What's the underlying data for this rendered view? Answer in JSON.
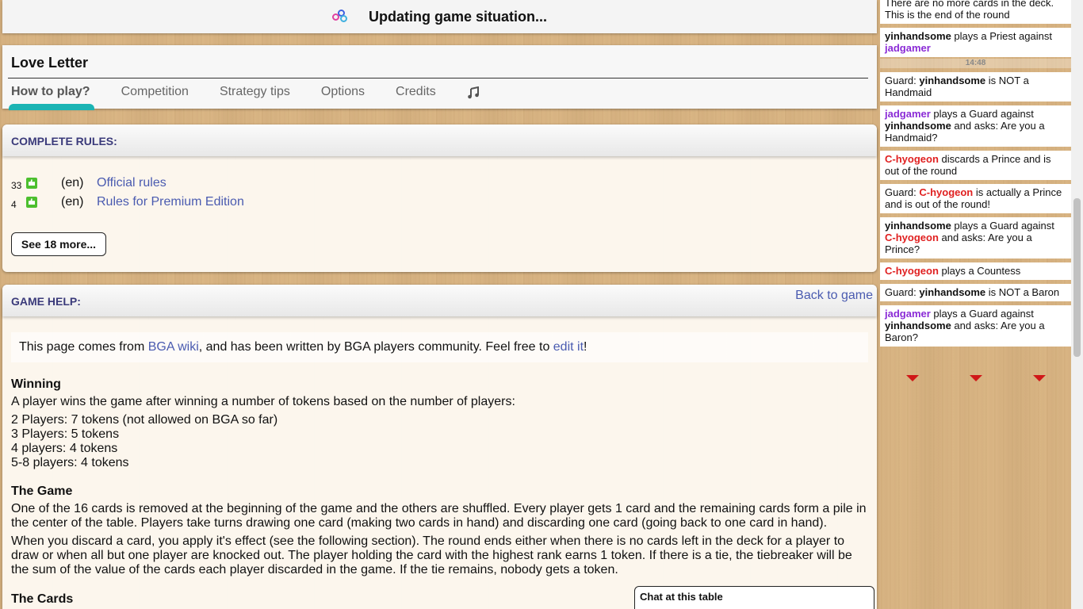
{
  "status": {
    "text": "Updating game situation..."
  },
  "header": {
    "title": "Love Letter",
    "tabs": [
      "How to play?",
      "Competition",
      "Strategy tips",
      "Options",
      "Credits"
    ]
  },
  "rules": {
    "title": "COMPLETE RULES:",
    "items": [
      {
        "count": "33",
        "lang": "(en)",
        "label": "Official rules"
      },
      {
        "count": "4",
        "lang": "(en)",
        "label": "Rules for Premium Edition"
      }
    ],
    "more_label": "See 18 more..."
  },
  "help": {
    "title": "GAME HELP:",
    "back_label": "Back to game",
    "notice_pre": "This page comes from ",
    "notice_link1": "BGA wiki",
    "notice_mid": ", and has been written by BGA players community. Feel free to ",
    "notice_link2": "edit it",
    "notice_post": "!",
    "winning_title": "Winning",
    "winning_intro": "A player wins the game after winning a number of tokens based on the number of players:",
    "winning_list": [
      "2 Players: 7 tokens (not allowed on BGA so far)",
      "3 Players: 5 tokens",
      "4 players: 4 tokens",
      "5-8 players: 4 tokens"
    ],
    "game_title": "The Game",
    "game_p1": "One of the 16 cards is removed at the beginning of the game and the others are shuffled. Every player gets 1 card and the remaining cards form a pile in the center of the table. Players take turns drawing one card (making two cards in hand) and discarding one card (going back to one card in hand).",
    "game_p2": "When you discard a card, you apply it's effect (see the following section). The round ends either when there is no cards left in the deck for a player to draw or when all but one player are knocked out. The player holding the card with the highest rank earns 1 token. If there is a tie, the tiebreaker will be the sum of the value of the cards each player discarded in the game. If the tie remains, nobody gets a token.",
    "cards_title": "The Cards"
  },
  "chat": {
    "title": "Chat at this table"
  },
  "log": {
    "time": "14:48",
    "entries": [
      {
        "parts": [
          [
            "",
            "There are no more cards in the deck. This is the end of the round"
          ]
        ]
      },
      {
        "parts": [
          [
            "yin",
            "yinhandsome"
          ],
          [
            "",
            " plays a Priest against "
          ],
          [
            "jad",
            "jadgamer"
          ]
        ]
      },
      {
        "parts": [
          [
            "",
            "Guard: "
          ],
          [
            "yin",
            "yinhandsome"
          ],
          [
            "",
            " is NOT a Handmaid"
          ]
        ]
      },
      {
        "parts": [
          [
            "jad",
            "jadgamer"
          ],
          [
            "",
            " plays a Guard against "
          ],
          [
            "yin",
            "yinhandsome"
          ],
          [
            "",
            " and asks: Are you a Handmaid?"
          ]
        ]
      },
      {
        "parts": [
          [
            "c",
            "C-hyogeon"
          ],
          [
            "",
            " discards a Prince and is out of the round"
          ]
        ]
      },
      {
        "parts": [
          [
            "",
            "Guard: "
          ],
          [
            "c",
            "C-hyogeon"
          ],
          [
            "",
            " is actually a Prince and is out of the round!"
          ]
        ]
      },
      {
        "parts": [
          [
            "yin",
            "yinhandsome"
          ],
          [
            "",
            " plays a Guard against "
          ],
          [
            "c",
            "C-hyogeon"
          ],
          [
            "",
            " and asks: Are you a Prince?"
          ]
        ]
      },
      {
        "parts": [
          [
            "c",
            "C-hyogeon"
          ],
          [
            "",
            " plays a Countess"
          ]
        ]
      },
      {
        "parts": [
          [
            "",
            "Guard: "
          ],
          [
            "yin",
            "yinhandsome"
          ],
          [
            "",
            " is NOT a Baron"
          ]
        ]
      },
      {
        "parts": [
          [
            "jad",
            "jadgamer"
          ],
          [
            "",
            " plays a Guard against "
          ],
          [
            "yin",
            "yinhandsome"
          ],
          [
            "",
            " and asks: Are you a Baron?"
          ]
        ]
      }
    ]
  },
  "colors": {
    "accent_tab": "#1bb4b4",
    "link": "#4a5bb0",
    "player_jad": "#8a2ad6",
    "player_c": "#e02020"
  }
}
